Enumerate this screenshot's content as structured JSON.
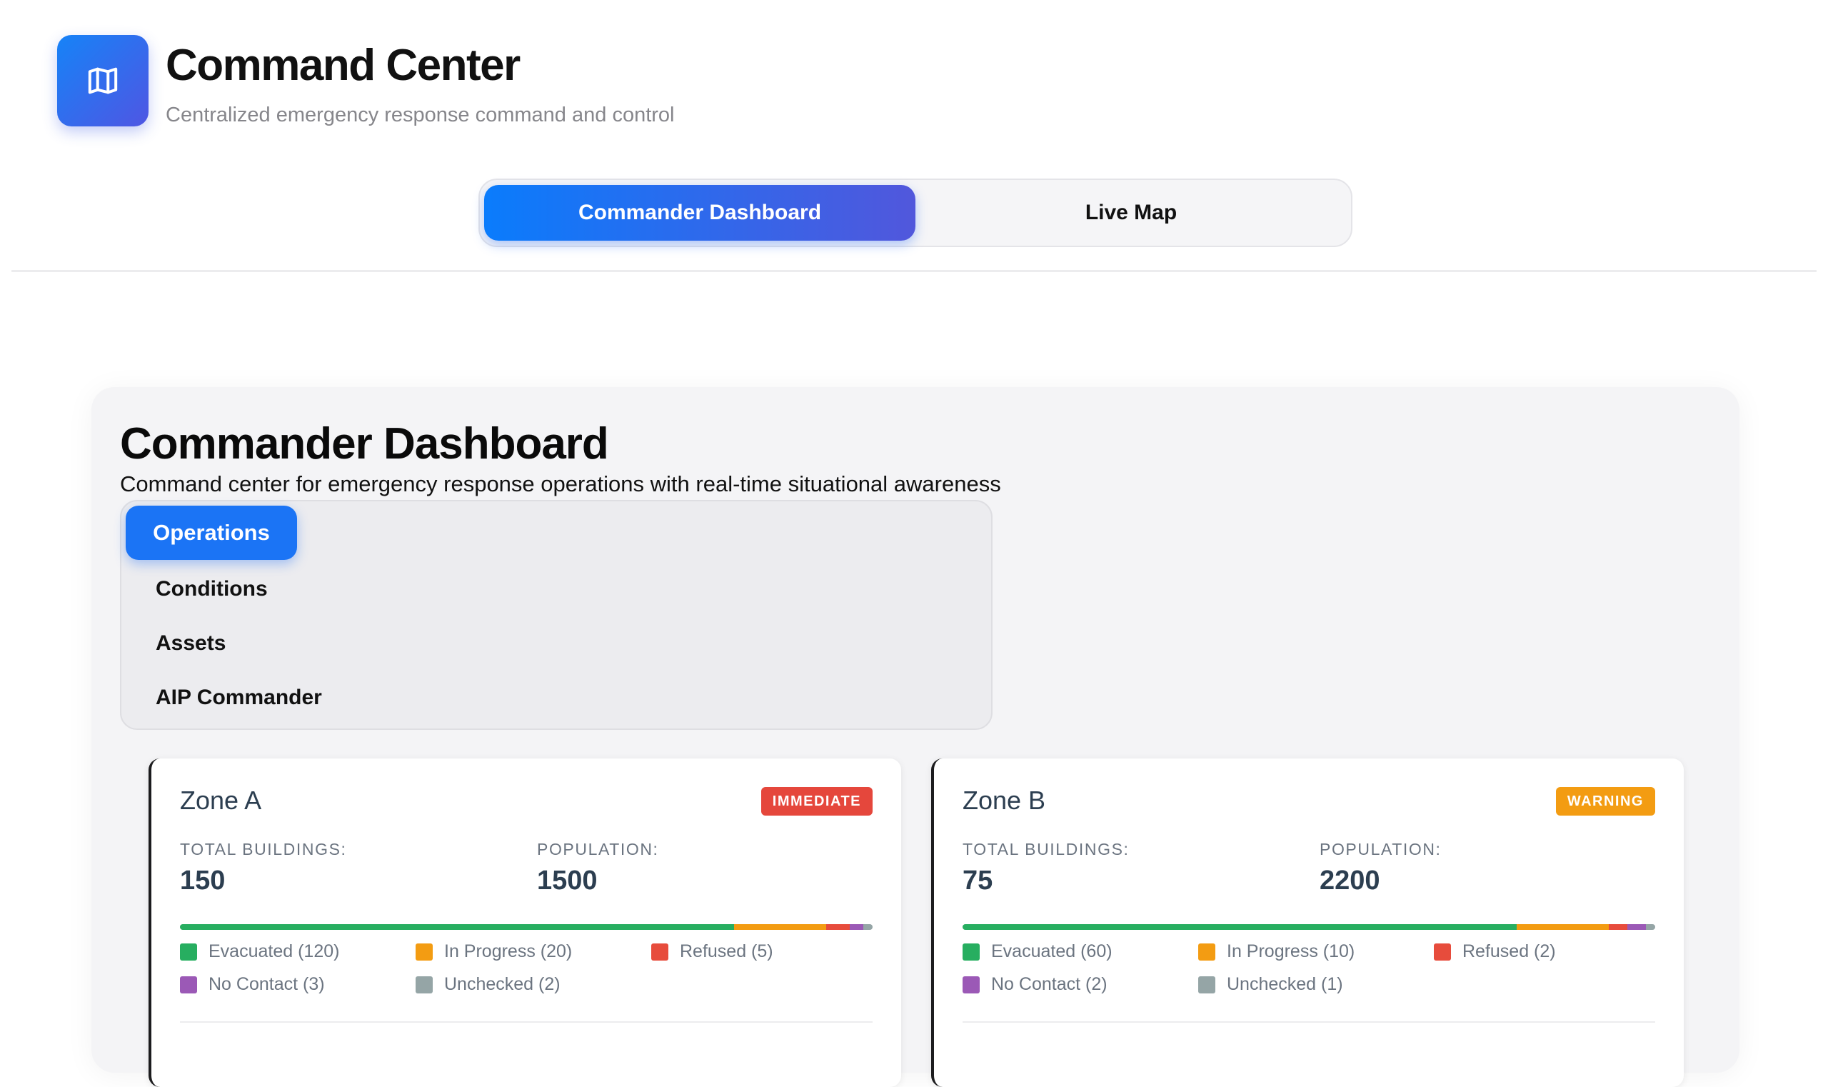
{
  "app": {
    "title": "Command Center",
    "subtitle": "Centralized emergency response command and control",
    "logo_icon": "map-icon",
    "accent": "#0a7cfc"
  },
  "top_tabs": [
    {
      "label": "Commander Dashboard",
      "active": true
    },
    {
      "label": "Live Map",
      "active": false
    }
  ],
  "dashboard": {
    "title": "Commander Dashboard",
    "subtitle": "Command center for emergency response operations with real-time situational awareness",
    "sub_nav": [
      {
        "label": "Operations",
        "active": true
      },
      {
        "label": "Conditions",
        "active": false
      },
      {
        "label": "Assets",
        "active": false
      },
      {
        "label": "AIP Commander",
        "active": false
      }
    ]
  },
  "zones": [
    {
      "name": "Zone A",
      "badge": "IMMEDIATE",
      "badge_color": "#e5473c",
      "buildings_label": "TOTAL BUILDINGS:",
      "buildings": "150",
      "population_label": "POPULATION:",
      "population": "1500",
      "breakdown": [
        {
          "label": "Evacuated (120)",
          "count": 120,
          "color": "#27ae60"
        },
        {
          "label": "In Progress (20)",
          "count": 20,
          "color": "#f39c12"
        },
        {
          "label": "Refused (5)",
          "count": 5,
          "color": "#e74c3c"
        },
        {
          "label": "No Contact (3)",
          "count": 3,
          "color": "#9b59b6"
        },
        {
          "label": "Unchecked (2)",
          "count": 2,
          "color": "#95a5a6"
        }
      ]
    },
    {
      "name": "Zone B",
      "badge": "WARNING",
      "badge_color": "#f39c12",
      "buildings_label": "TOTAL BUILDINGS:",
      "buildings": "75",
      "population_label": "POPULATION:",
      "population": "2200",
      "breakdown": [
        {
          "label": "Evacuated (60)",
          "count": 60,
          "color": "#27ae60"
        },
        {
          "label": "In Progress (10)",
          "count": 10,
          "color": "#f39c12"
        },
        {
          "label": "Refused (2)",
          "count": 2,
          "color": "#e74c3c"
        },
        {
          "label": "No Contact (2)",
          "count": 2,
          "color": "#9b59b6"
        },
        {
          "label": "Unchecked (1)",
          "count": 1,
          "color": "#95a5a6"
        }
      ]
    }
  ]
}
